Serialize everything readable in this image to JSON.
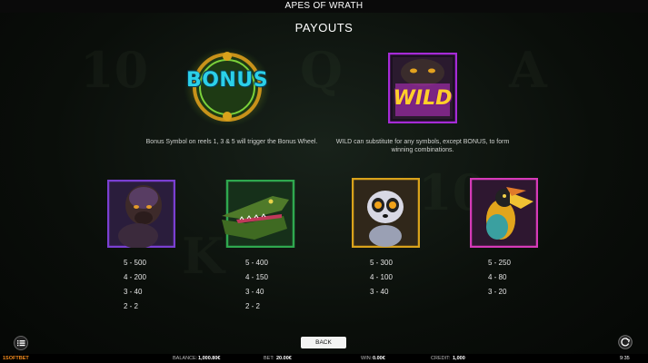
{
  "window": {
    "title": "APES OF WRATH"
  },
  "page": {
    "heading": "PAYOUTS"
  },
  "bonus": {
    "logo_text": "BONUS",
    "description": "Bonus Symbol on reels 1, 3 & 5 will trigger the Bonus Wheel."
  },
  "wild": {
    "logo_text": "WILD",
    "description": "WILD can substitute for any symbols, except BONUS, to form winning combinations."
  },
  "symbols": [
    {
      "name": "gorilla",
      "payouts": [
        "5 - 500",
        "4 - 200",
        "3 - 40",
        "2 - 2"
      ]
    },
    {
      "name": "crocodile",
      "payouts": [
        "5 - 400",
        "4 - 150",
        "3 - 40",
        "2 - 2"
      ]
    },
    {
      "name": "lemur",
      "payouts": [
        "5 - 300",
        "4 - 100",
        "3 - 40"
      ]
    },
    {
      "name": "hornbill",
      "payouts": [
        "5 - 250",
        "4 - 80",
        "3 - 20"
      ]
    }
  ],
  "buttons": {
    "back": "BACK"
  },
  "bottom_bar": {
    "brand": "1SOFTBET",
    "balance_label": "BALANCE:",
    "balance_value": "1,000.80€",
    "bet_label": "BET:",
    "bet_value": "20.00€",
    "win_label": "WIN:",
    "win_value": "0.00€",
    "credit_label": "CREDIT:",
    "credit_value": "1,000",
    "clock": "9:35"
  },
  "colors": {
    "bonus_gold": "#d9a21b",
    "wild_purple": "#a52bd6",
    "gorilla_frame": "#7a3fd1",
    "croc_frame": "#2fa84f",
    "lemur_frame": "#d9a21b",
    "hornbill_frame": "#d63ab8",
    "brand_orange": "#f28a1c"
  }
}
